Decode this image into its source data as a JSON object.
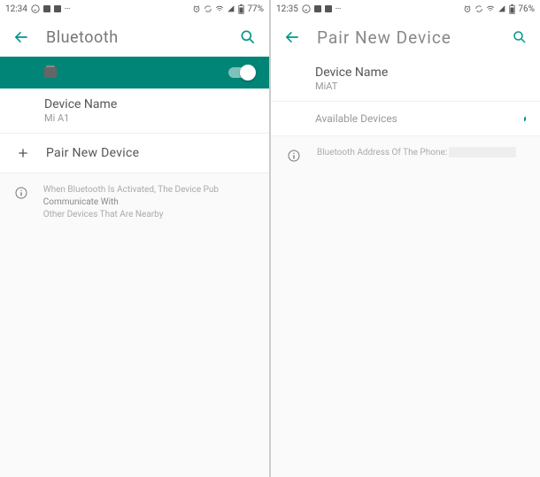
{
  "left": {
    "status": {
      "time": "12:34",
      "battery": "77%"
    },
    "title": "Bluetooth",
    "device_name_label": "Device Name",
    "device_name_value": "Mi A1",
    "pair_label": "Pair New Device",
    "info_text_a": "When Bluetooth Is Activated, The Device Pub",
    "info_text_b": "Communicate With",
    "info_text_c": "Other Devices That Are Nearby"
  },
  "right": {
    "status": {
      "time": "12:35",
      "battery": "76%"
    },
    "title": "Pair New Device",
    "device_name_label": "Device Name",
    "device_name_value": "MiAT",
    "available_label": "Available Devices",
    "addr_label": "Bluetooth Address Of The Phone:"
  }
}
